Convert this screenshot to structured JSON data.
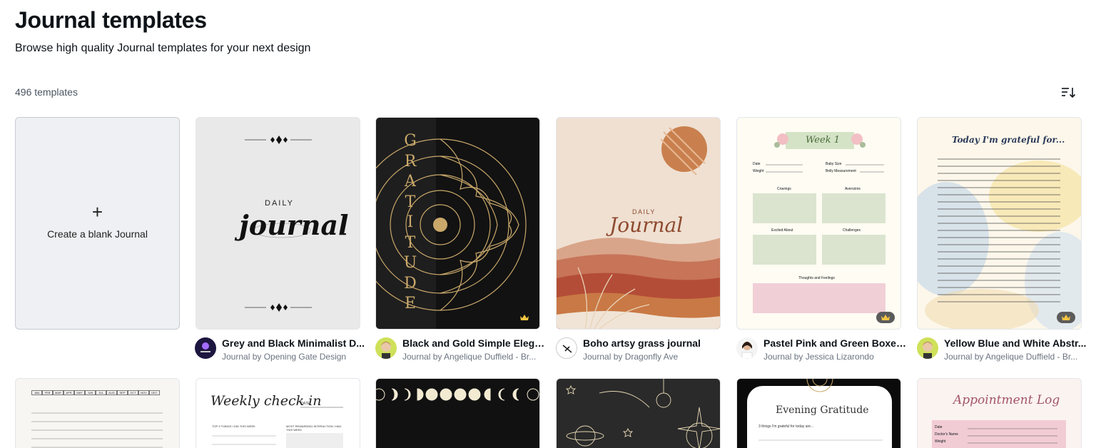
{
  "header": {
    "title": "Journal templates",
    "subtitle": "Browse high quality Journal templates for your next design",
    "count": "496 templates"
  },
  "blank_card": {
    "plus": "+",
    "label": "Create a blank Journal"
  },
  "templates": [
    {
      "title": "Grey and Black Minimalist D...",
      "subtitle": "Journal by Opening Gate Design",
      "premium": false
    },
    {
      "title": "Black and Gold Simple Elega...",
      "subtitle": "Journal by Angelique Duffield - Br...",
      "premium": true
    },
    {
      "title": "Boho artsy grass journal",
      "subtitle": "Journal by Dragonfly Ave",
      "premium": false
    },
    {
      "title": "Pastel Pink and Green Boxes...",
      "subtitle": "Journal by Jessica Lizarondo",
      "premium": true
    },
    {
      "title": "Yellow Blue and White Abstr...",
      "subtitle": "Journal by Angelique Duffield - Br...",
      "premium": true
    }
  ],
  "thumb_text": {
    "daily": "DAILY",
    "journal": "journal",
    "gratitude": [
      "G",
      "R",
      "A",
      "T",
      "I",
      "T",
      "U",
      "D",
      "E"
    ],
    "boho_daily": "DAILY",
    "boho_journal": "Journal",
    "week": "Week 1",
    "date": "Date",
    "weight": "Weight",
    "baby_size": "Baby Size",
    "belly": "Belly Measurement",
    "cravings": "Cravings",
    "aversions": "Aversions",
    "excited": "Excited About",
    "challenges": "Challenges",
    "thoughts": "Thoughts and Feelings",
    "grateful": "Today I'm grateful for...",
    "weekly": "Weekly check in",
    "weekly_date": "DATE",
    "weekly_left": "TOP 3 THINGS I DID THIS WEEK",
    "weekly_right": "MOST REWARDING INTERACTION I HAD THIS WEEK",
    "evening": "Evening Gratitude",
    "evening_sub": "3 things I'm grateful for today are...",
    "appointment": "Appointment Log",
    "appt_date": "Date",
    "appt_doctor": "Doctor's Name",
    "appt_weight": "Weight",
    "months": [
      "JAN",
      "FEB",
      "MAR",
      "APR",
      "MAY",
      "JUN",
      "JUL",
      "AUG",
      "SEP",
      "OCT",
      "NOV",
      "DEC"
    ]
  },
  "colors": {
    "accent_gold": "#c9a86a",
    "crown_bg": "#5b5b5b",
    "crown_icon": "#f5c542"
  }
}
